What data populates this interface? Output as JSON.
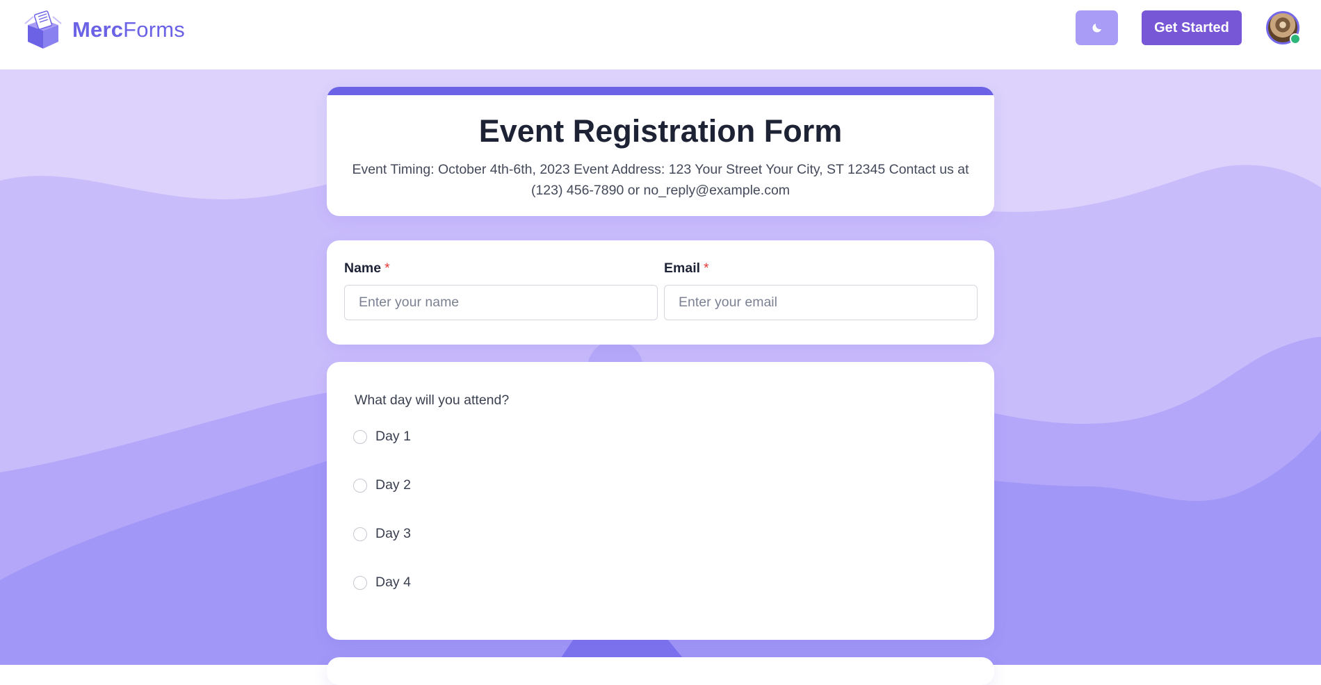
{
  "header": {
    "brand_bold": "Merc",
    "brand_light": "Forms",
    "cta_label": "Get Started"
  },
  "form": {
    "title": "Event Registration Form",
    "description": "Event Timing: October 4th-6th, 2023 Event Address: 123 Your Street Your City, ST 12345 Contact us at (123) 456-7890 or no_reply@example.com",
    "fields": [
      {
        "label": "Name",
        "required_mark": "*",
        "placeholder": "Enter your name",
        "value": ""
      },
      {
        "label": "Email",
        "required_mark": "*",
        "placeholder": "Enter your email",
        "value": ""
      }
    ],
    "question": {
      "text": "What day will you attend?",
      "options": [
        "Day 1",
        "Day 2",
        "Day 3",
        "Day 4"
      ],
      "selected": null
    }
  },
  "icons": {
    "theme_toggle": "moon-icon",
    "logo": "box-logo-icon",
    "avatar_status": "online-status-icon"
  },
  "colors": {
    "accent": "#6b62e6",
    "cta": "#7857d6",
    "theme_button": "#a99cf7",
    "background": "#dcd2fc",
    "required": "#e23b3b",
    "status_online": "#2db67a"
  }
}
